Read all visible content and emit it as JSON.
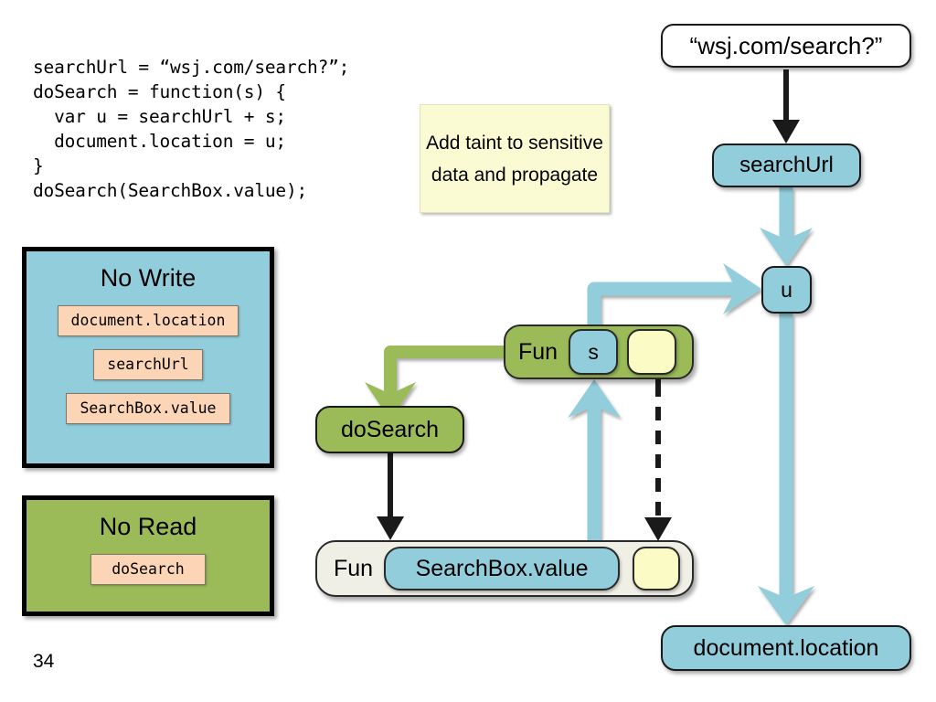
{
  "slide": {
    "page_number": "34"
  },
  "code": {
    "text": "searchUrl = “wsj.com/search?”;\ndoSearch = function(s) {\n  var u = searchUrl + s;\n  document.location = u;\n}\ndoSearch(SearchBox.value);"
  },
  "note": {
    "text": "Add taint to sensitive data and propagate"
  },
  "panels": [
    {
      "title": "No Write",
      "items": [
        "document.location",
        "searchUrl",
        "SearchBox.value"
      ],
      "background": "#92CDDC"
    },
    {
      "title": "No Read",
      "items": [
        "doSearch"
      ],
      "background": "#9BBB59"
    }
  ],
  "graph": {
    "nodes": {
      "url_literal": "“wsj.com/search?”",
      "search_url": "searchUrl",
      "u": "u",
      "document_location": "document.location",
      "do_search": "doSearch"
    },
    "fun_top": {
      "label": "Fun",
      "blue_slot": "s",
      "yellow_slot": ""
    },
    "fun_bottom": {
      "label": "Fun",
      "blue_slot": "SearchBox.value",
      "yellow_slot": ""
    }
  },
  "colors": {
    "taint_blue": "#92CDDC",
    "green": "#9BBB59",
    "peach": "#FBD5B5",
    "note_yellow": "#FBFBD3",
    "slot_yellow": "#FBFBC6",
    "capsule_gray": "#EFEFE6",
    "black": "#000000"
  }
}
